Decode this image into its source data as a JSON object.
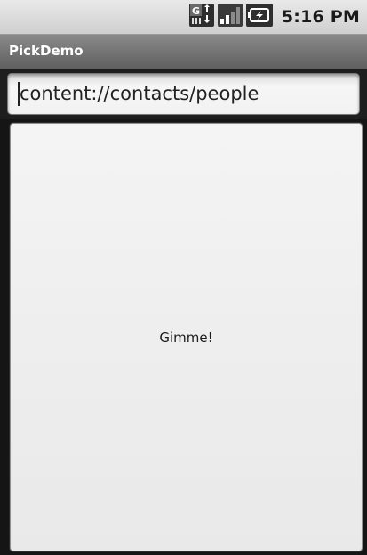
{
  "status_bar": {
    "time": "5:16 PM",
    "icons": [
      "data-transfer-icon",
      "signal-strength-icon",
      "battery-charging-icon"
    ]
  },
  "app": {
    "title": "PickDemo"
  },
  "uri_field": {
    "value": "content://contacts/people"
  },
  "gimme_button": {
    "label": "Gimme!"
  }
}
